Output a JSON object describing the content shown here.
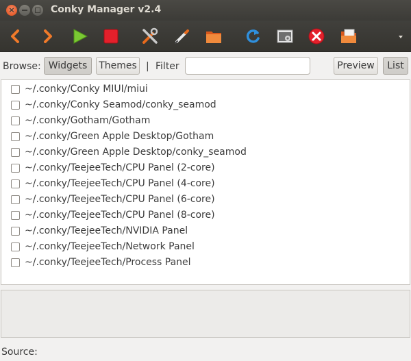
{
  "window": {
    "title": "Conky Manager v2.4"
  },
  "toolbar": {
    "icons": [
      "previous-icon",
      "next-icon",
      "start-icon",
      "stop-icon",
      "settings-icon",
      "edit-icon",
      "open-folder-icon",
      "refresh-icon",
      "desktop-settings-icon",
      "kill-icon",
      "export-icon",
      "menu-icon"
    ]
  },
  "browse": {
    "label": "Browse:",
    "widgets_label": "Widgets",
    "themes_label": "Themes",
    "separator": "|",
    "filter_label": "Filter",
    "filter_value": "",
    "preview_label": "Preview",
    "list_label": "List"
  },
  "widgets": [
    {
      "path": "~/.conky/Conky MIUI/miui",
      "checked": false
    },
    {
      "path": "~/.conky/Conky Seamod/conky_seamod",
      "checked": false
    },
    {
      "path": "~/.conky/Gotham/Gotham",
      "checked": false
    },
    {
      "path": "~/.conky/Green Apple Desktop/Gotham",
      "checked": false
    },
    {
      "path": "~/.conky/Green Apple Desktop/conky_seamod",
      "checked": false
    },
    {
      "path": "~/.conky/TeejeeTech/CPU Panel (2-core)",
      "checked": false
    },
    {
      "path": "~/.conky/TeejeeTech/CPU Panel (4-core)",
      "checked": false
    },
    {
      "path": "~/.conky/TeejeeTech/CPU Panel (6-core)",
      "checked": false
    },
    {
      "path": "~/.conky/TeejeeTech/CPU Panel (8-core)",
      "checked": false
    },
    {
      "path": "~/.conky/TeejeeTech/NVIDIA Panel",
      "checked": false
    },
    {
      "path": "~/.conky/TeejeeTech/Network Panel",
      "checked": false
    },
    {
      "path": "~/.conky/TeejeeTech/Process Panel",
      "checked": false
    }
  ],
  "footer": {
    "source_label": "Source:"
  }
}
